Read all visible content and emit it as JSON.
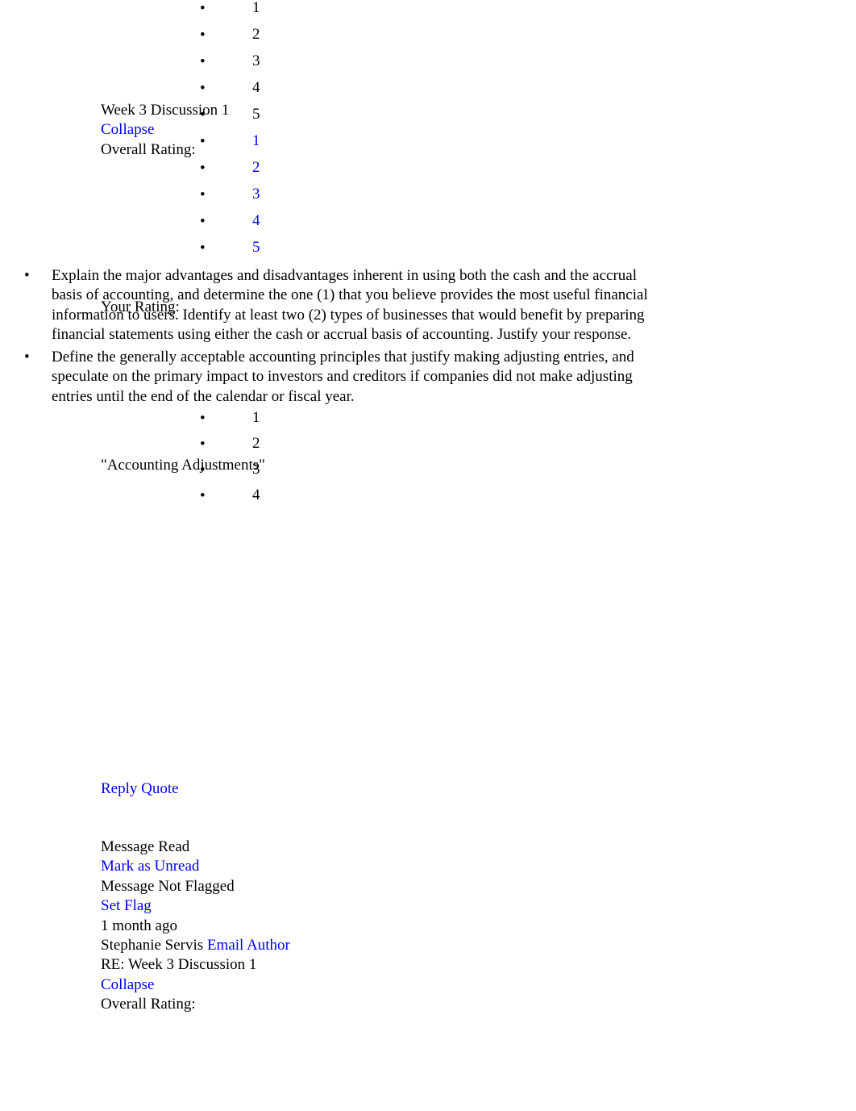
{
  "document": {
    "thread_title": "Week 3 Discussion 1",
    "collapse_label": "Collapse",
    "overall_rating_label": "Overall Rating:",
    "your_rating_label": "Your Rating:",
    "rating_options": [
      "1",
      "2",
      "3",
      "4",
      "5"
    ],
    "bullet_glyph": "•"
  },
  "prompt": {
    "title": "\"Accounting Adjustments\"",
    "items": [
      "Explain the major advantages and disadvantages inherent in using both the cash and the accrual basis of accounting, and determine the one (1) that you believe provides the most useful financial information to users. Identify at least two (2) types of businesses that would benefit by preparing financial statements using either the cash or accrual basis of accounting. Justify your response.",
      "Define the generally acceptable accounting principles that justify making adjusting entries, and speculate on the primary impact to investors and creditors if companies did not make adjusting entries until the end of the calendar or fiscal year."
    ]
  },
  "actions": {
    "reply_quote": "Reply Quote"
  },
  "message_meta": {
    "read_status": "Message Read",
    "mark_as_unread": "Mark as Unread",
    "flag_status": "Message Not Flagged",
    "set_flag": "Set Flag",
    "timestamp": "1 month ago",
    "author": "Stephanie Servis",
    "email_author": "Email Author",
    "reply_title": "RE: Week 3 Discussion 1",
    "collapse_label": "Collapse",
    "overall_rating_label": "Overall Rating:"
  },
  "reply_rating_options": [
    "1",
    "2",
    "3",
    "4"
  ],
  "colors": {
    "link": "#0000FF",
    "text": "#000000",
    "background": "#FFFFFF"
  }
}
